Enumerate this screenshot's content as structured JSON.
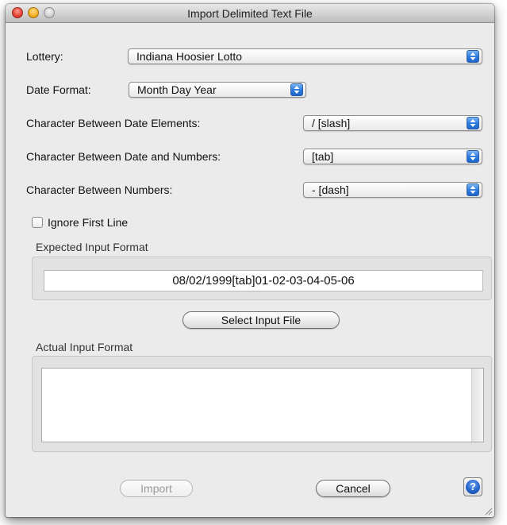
{
  "window": {
    "title": "Import Delimited Text File"
  },
  "form": {
    "lottery": {
      "label": "Lottery:",
      "value": "Indiana Hoosier Lotto"
    },
    "date_format": {
      "label": "Date Format:",
      "value": "Month Day Year"
    },
    "date_sep": {
      "label": "Character Between Date Elements:",
      "value": "/ [slash]"
    },
    "date_num_sep": {
      "label": "Character Between Date and Numbers:",
      "value": "[tab]"
    },
    "num_sep": {
      "label": "Character Between Numbers:",
      "value": "- [dash]"
    },
    "ignore_first_line": {
      "label": "Ignore First Line",
      "checked": false
    }
  },
  "expected": {
    "title": "Expected Input Format",
    "value": "08/02/1999[tab]01-02-03-04-05-06"
  },
  "select_button": "Select Input File",
  "actual": {
    "title": "Actual Input Format",
    "value": ""
  },
  "buttons": {
    "import": "Import",
    "cancel": "Cancel",
    "help": "?"
  }
}
